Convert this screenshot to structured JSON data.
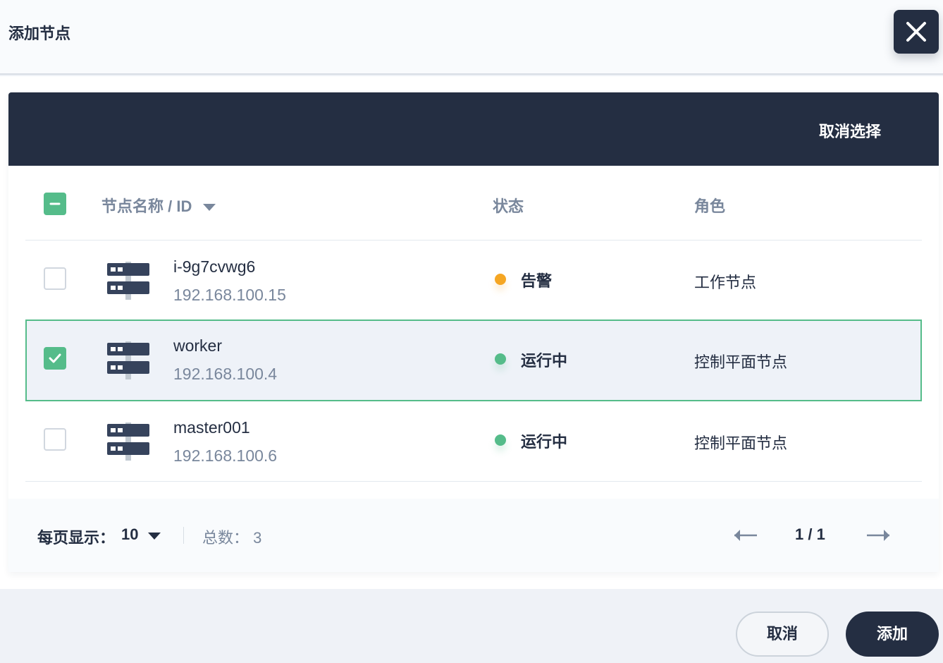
{
  "header": {
    "title": "添加节点"
  },
  "icons": {
    "close": "close-icon",
    "server": "server-icon",
    "checkmark": "check-icon",
    "minus": "minus-icon",
    "caret": "caret-down-icon",
    "prev": "arrow-left-icon",
    "next": "arrow-right-icon"
  },
  "toolbar": {
    "deselect_label": "取消选择"
  },
  "table": {
    "headers": {
      "name": "节点名称 / ID",
      "status": "状态",
      "role": "角色"
    },
    "rows": [
      {
        "name": "i-9g7cvwg6",
        "ip": "192.168.100.15",
        "status": "告警",
        "status_color": "#f5a623",
        "role": "工作节点",
        "selected": false
      },
      {
        "name": "worker",
        "ip": "192.168.100.4",
        "status": "运行中",
        "status_color": "#55bc8a",
        "role": "控制平面节点",
        "selected": true
      },
      {
        "name": "master001",
        "ip": "192.168.100.6",
        "status": "运行中",
        "status_color": "#55bc8a",
        "role": "控制平面节点",
        "selected": false
      }
    ]
  },
  "pagination": {
    "per_page_label": "每页显示：",
    "per_page_value": "10",
    "total_label": "总数：  3",
    "page_info": "1 / 1"
  },
  "actions": {
    "cancel_label": "取消",
    "add_label": "添加"
  },
  "colors": {
    "dark": "#242e42",
    "accent_green": "#55bc8a",
    "warning": "#f5a623",
    "muted": "#79879c"
  }
}
